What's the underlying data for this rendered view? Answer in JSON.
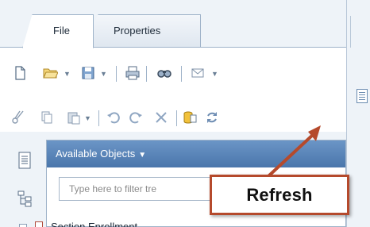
{
  "tabs": [
    {
      "label": "File",
      "active": true
    },
    {
      "label": "Properties",
      "active": false
    }
  ],
  "toolbar": {
    "row1": [
      "new-document-icon",
      "open-folder-icon",
      "save-icon",
      "print-icon",
      "find-icon",
      "mail-icon"
    ],
    "row2": [
      "cut-icon",
      "copy-icon",
      "paste-icon",
      "undo-icon",
      "redo-icon",
      "delete-icon",
      "query-icon",
      "refresh-icon"
    ]
  },
  "objects_panel": {
    "title": "Available Objects",
    "filter_placeholder": "Type here to filter tre",
    "items": [
      {
        "label": "Section Enrollment"
      }
    ]
  },
  "callout": {
    "text": "Refresh"
  },
  "colors": {
    "panel_header": "#5a86bb",
    "callout_border": "#b54a2c",
    "arrow": "#b54a2c"
  }
}
